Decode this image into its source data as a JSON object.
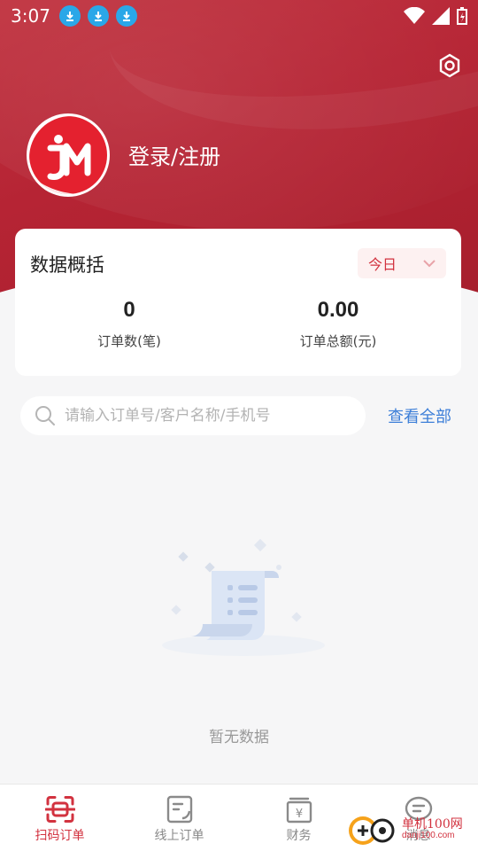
{
  "status_bar": {
    "time": "3:07",
    "download_icons": [
      "download-icon",
      "download-icon",
      "download-icon"
    ],
    "right_icons": [
      "wifi-icon",
      "signal-icon",
      "battery-icon"
    ]
  },
  "header": {
    "login_label": "登录/注册",
    "settings_icon": "settings-icon",
    "avatar_logo_text": "JM"
  },
  "overview": {
    "title": "数据概括",
    "period_selected": "今日",
    "stats": [
      {
        "value": "0",
        "label": "订单数(笔)"
      },
      {
        "value": "0.00",
        "label": "订单总额(元)"
      }
    ]
  },
  "search": {
    "placeholder": "请输入订单号/客户名称/手机号",
    "view_all_label": "查看全部"
  },
  "empty_state": {
    "text": "暂无数据"
  },
  "tabbar": {
    "items": [
      {
        "label": "扫码订单",
        "icon": "scan-icon",
        "active": true
      },
      {
        "label": "线上订单",
        "icon": "note-icon",
        "active": false
      },
      {
        "label": "财务",
        "icon": "finance-icon",
        "active": false
      },
      {
        "label": "消息",
        "icon": "message-icon",
        "active": false
      }
    ]
  },
  "watermark": {
    "text": "单机100网",
    "url": "danji100.com"
  },
  "colors": {
    "brand": "#b62434",
    "accent": "#d2323f",
    "link": "#3d7fd8"
  }
}
